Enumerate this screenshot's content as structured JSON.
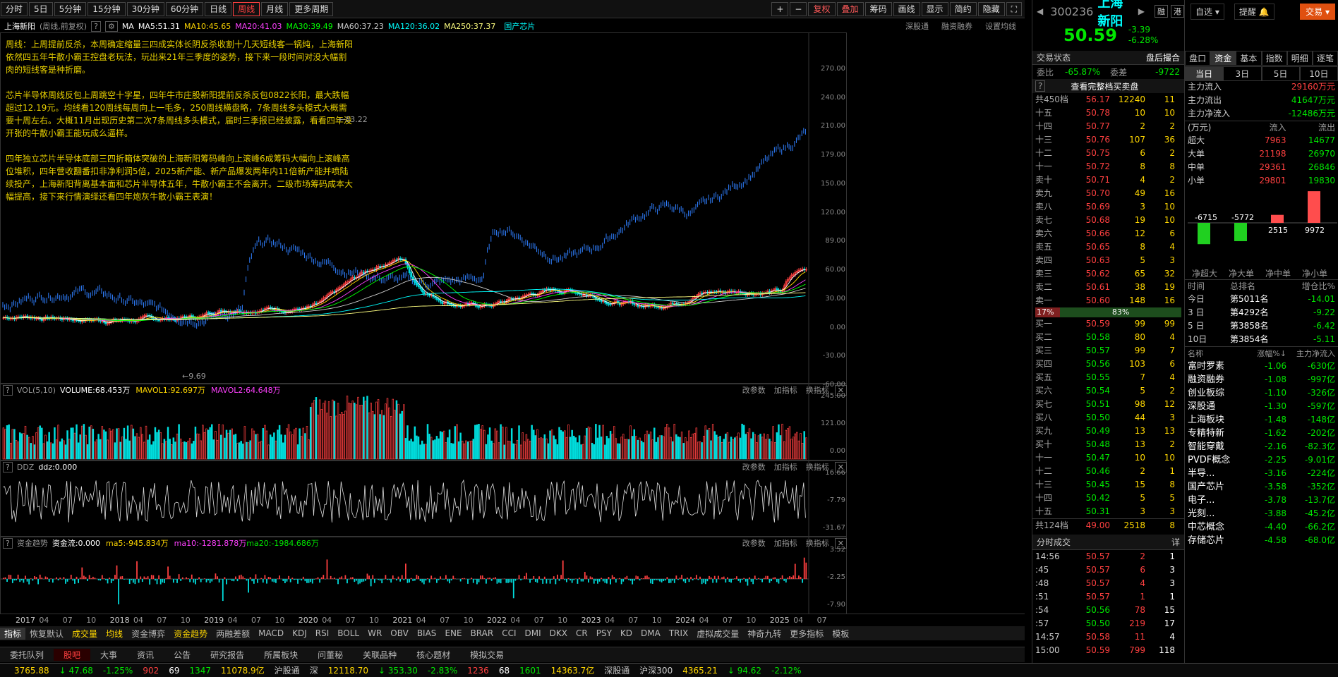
{
  "toolbar": {
    "periods": [
      "分时",
      "5日",
      "5分钟",
      "15分钟",
      "30分钟",
      "60分钟",
      "日线",
      "周线",
      "月线",
      "更多周期"
    ],
    "active": "周线",
    "right": [
      "+",
      "−",
      "复权",
      "叠加",
      "筹码",
      "画线",
      "显示",
      "简约",
      "隐藏"
    ]
  },
  "ma_line": {
    "name": "上海新阳",
    "sub": "(周线,前复权)",
    "ma": "MA",
    "items": [
      {
        "t": "MA5:51.31",
        "c": "#ffffff"
      },
      {
        "t": "MA10:45.65",
        "c": "#ffd700"
      },
      {
        "t": "MA20:41.03",
        "c": "#ff40ff"
      },
      {
        "t": "MA30:39.49",
        "c": "#00ff00"
      },
      {
        "t": "MA60:37.23",
        "c": "#cccccc"
      },
      {
        "t": "MA120:36.02",
        "c": "#00ffff"
      },
      {
        "t": "MA250:37.37",
        "c": "#ffff80"
      }
    ],
    "tag": "国产芯片",
    "links": [
      "深股通",
      "融资融券",
      "设置均线"
    ]
  },
  "note": "周线：上周提前反杀，本周确定缩量三四成实体长阴反杀收割十几天短线客一锅炖，上海新阳依然四五年牛散小霸王控盘老玩法，玩出来21年三季度的姿势，接下来一段时间对没大幅割肉的短线客是种折磨。\n\n芯片半导体周线反包上周跳空十字星，四年牛市庄股新阳提前反杀反包0822长阳，最大跌幅超过12.19元。均线看120周线每周向上一毛多，250周线横盘略，7条周线多头模式大概需要十周左右。大概11月出现历史第二次7条周线多头模式，届时三季报已经披露，看看四年没开张的牛散小霸王能玩成么逼样。\n\n四年独立芯片半导体底部三四折箱体突破的上海新阳筹码峰向上滚峰6成筹码大幅向上滚峰高位堆积，四年营收翻番扣非净利润5倍，2025新产能、新产品爆发两年内11倍新产能并喷陆续投产，上海新阳背离基本面和芯片半导体五年，牛散小霸王不会离开。二级市场筹码成本大幅提高，接下来行情演绎还看四年炮灰牛散小霸王表演！",
  "main_axis": [
    "270.00",
    "240.00",
    "210.00",
    "179.00",
    "150.00",
    "120.00",
    "89.00",
    "60.00",
    "30.00",
    "0.00",
    "-30.00",
    "-60.00"
  ],
  "labels": {
    "high": "83.22",
    "low": "9.69"
  },
  "vol": {
    "head": "VOL(5,10)",
    "volume": "VOLUME:68.453万",
    "mavol1": "MAVOL1:92.697万",
    "mavol2": "MAVOL2:64.648万",
    "axis": [
      "245.00",
      "121.00",
      "0.00"
    ]
  },
  "ddz": {
    "head": "DDZ",
    "val": "ddz:0.000",
    "axis": [
      "16.66",
      "-7.79",
      "-31.67"
    ]
  },
  "zjqs": {
    "head": "资金趋势",
    "val": "资金流:0.000",
    "ma5": "ma5:-945.834万",
    "ma10": "ma10:-1281.878万",
    "ma20": "ma20:-1984.686万",
    "axis": [
      "3.52",
      "-2.25",
      "-7.90"
    ]
  },
  "pane_links": [
    "改参数",
    "加指标",
    "换指标"
  ],
  "time_axis": [
    "2017",
    "04",
    "07",
    "10",
    "2018",
    "04",
    "07",
    "10",
    "2019",
    "04",
    "07",
    "10",
    "2020",
    "04",
    "07",
    "10",
    "2021",
    "04",
    "07",
    "10",
    "2022",
    "04",
    "07",
    "10",
    "2023",
    "04",
    "07",
    "10",
    "2024",
    "04",
    "07",
    "10",
    "2025",
    "04",
    "07"
  ],
  "ind_bar": [
    "指标",
    "恢复默认",
    "成交量",
    "均线",
    "资金博弈",
    "资金趋势",
    "两融差额",
    "MACD",
    "KDJ",
    "RSI",
    "BOLL",
    "WR",
    "OBV",
    "BIAS",
    "ENE",
    "BRAR",
    "CCI",
    "DMI",
    "DKX",
    "CR",
    "PSY",
    "KD",
    "DMA",
    "TRIX",
    "虚拟成交量",
    "神奇九转",
    "更多指标",
    "模板"
  ],
  "bottom_tabs": [
    "委托队列",
    "股吧",
    "大事",
    "资讯",
    "公告",
    "研究报告",
    "所属板块",
    "问董秘",
    "关联品种",
    "核心题材",
    "模拟交易"
  ],
  "status": [
    {
      "t": "3765.88",
      "c": "#ffd700"
    },
    {
      "t": "↓ 47.68",
      "c": "#00e600"
    },
    {
      "t": "-1.25%",
      "c": "#00e600"
    },
    {
      "t": "902",
      "c": "#ff4040"
    },
    {
      "t": "69",
      "c": "#fff"
    },
    {
      "t": "1347",
      "c": "#00e600"
    },
    {
      "t": "11078.9亿",
      "c": "#ffd700"
    },
    {
      "t": "沪股通",
      "c": "#ccc"
    },
    {
      "t": "深",
      "c": "#ccc"
    },
    {
      "t": "12118.70",
      "c": "#ffd700"
    },
    {
      "t": "↓ 353.30",
      "c": "#00e600"
    },
    {
      "t": "-2.83%",
      "c": "#00e600"
    },
    {
      "t": "1236",
      "c": "#ff4040"
    },
    {
      "t": "68",
      "c": "#fff"
    },
    {
      "t": "1601",
      "c": "#00e600"
    },
    {
      "t": "14363.7亿",
      "c": "#ffd700"
    },
    {
      "t": "深股通",
      "c": "#ccc"
    },
    {
      "t": "沪深300",
      "c": "#ccc"
    },
    {
      "t": "4365.21",
      "c": "#ffd700"
    },
    {
      "t": "↓ 94.62",
      "c": "#00e600"
    },
    {
      "t": "-2.12%",
      "c": "#00e600"
    }
  ],
  "quote": {
    "code": "300236",
    "name": "上海新阳",
    "tags": [
      "融",
      "港"
    ],
    "price": "50.59",
    "chg": "-3.39",
    "pct": "-6.28%",
    "watch": "自选",
    "remind": "提醒",
    "trade": "交易"
  },
  "trade_status": {
    "label": "交易状态",
    "val": "盘后撮合",
    "wb_label": "委比",
    "wb": "-65.87%",
    "wc_label": "委差",
    "wc": "-9722",
    "full": "查看完整档买卖盘"
  },
  "sell_total": {
    "l": "共450档",
    "p": "56.17",
    "v": "12240",
    "c": "11"
  },
  "sells": [
    {
      "l": "十五",
      "p": "50.78",
      "v": "10",
      "c": "10"
    },
    {
      "l": "十四",
      "p": "50.77",
      "v": "2",
      "c": "2"
    },
    {
      "l": "十三",
      "p": "50.76",
      "v": "107",
      "c": "36"
    },
    {
      "l": "十二",
      "p": "50.75",
      "v": "6",
      "c": "2"
    },
    {
      "l": "十一",
      "p": "50.72",
      "v": "8",
      "c": "8"
    },
    {
      "l": "卖十",
      "p": "50.71",
      "v": "4",
      "c": "2"
    },
    {
      "l": "卖九",
      "p": "50.70",
      "v": "49",
      "c": "16"
    },
    {
      "l": "卖八",
      "p": "50.69",
      "v": "3",
      "c": "10"
    },
    {
      "l": "卖七",
      "p": "50.68",
      "v": "19",
      "c": "10"
    },
    {
      "l": "卖六",
      "p": "50.66",
      "v": "12",
      "c": "6"
    },
    {
      "l": "卖五",
      "p": "50.65",
      "v": "8",
      "c": "4"
    },
    {
      "l": "卖四",
      "p": "50.63",
      "v": "5",
      "c": "3"
    },
    {
      "l": "卖三",
      "p": "50.62",
      "v": "65",
      "c": "32"
    },
    {
      "l": "卖二",
      "p": "50.61",
      "v": "38",
      "c": "19"
    },
    {
      "l": "卖一",
      "p": "50.60",
      "v": "148",
      "c": "16"
    }
  ],
  "ratio": {
    "left": "17%",
    "right": "83%"
  },
  "buys": [
    {
      "l": "买一",
      "p": "50.59",
      "v": "99",
      "c": "99"
    },
    {
      "l": "买二",
      "p": "50.58",
      "v": "80",
      "c": "4"
    },
    {
      "l": "买三",
      "p": "50.57",
      "v": "99",
      "c": "7"
    },
    {
      "l": "买四",
      "p": "50.56",
      "v": "103",
      "c": "6"
    },
    {
      "l": "买五",
      "p": "50.55",
      "v": "7",
      "c": "4"
    },
    {
      "l": "买六",
      "p": "50.54",
      "v": "5",
      "c": "2"
    },
    {
      "l": "买七",
      "p": "50.51",
      "v": "98",
      "c": "12"
    },
    {
      "l": "买八",
      "p": "50.50",
      "v": "44",
      "c": "3"
    },
    {
      "l": "买九",
      "p": "50.49",
      "v": "13",
      "c": "13"
    },
    {
      "l": "买十",
      "p": "50.48",
      "v": "13",
      "c": "2"
    },
    {
      "l": "十一",
      "p": "50.47",
      "v": "10",
      "c": "10"
    },
    {
      "l": "十二",
      "p": "50.46",
      "v": "2",
      "c": "1"
    },
    {
      "l": "十三",
      "p": "50.45",
      "v": "15",
      "c": "8"
    },
    {
      "l": "十四",
      "p": "50.42",
      "v": "5",
      "c": "5"
    },
    {
      "l": "十五",
      "p": "50.31",
      "v": "3",
      "c": "3"
    }
  ],
  "buy_total": {
    "l": "共124档",
    "p": "49.00",
    "v": "2518",
    "c": "8"
  },
  "ticks_head": "分时成交",
  "ticks_more": "详",
  "ticks": [
    {
      "t": "14:56",
      "p": "50.57",
      "v": "2",
      "c": "1"
    },
    {
      "t": ":45",
      "p": "50.57",
      "v": "6",
      "c": "3"
    },
    {
      "t": ":48",
      "p": "50.57",
      "v": "4",
      "c": "3"
    },
    {
      "t": ":51",
      "p": "50.57",
      "v": "1",
      "c": "1"
    },
    {
      "t": ":54",
      "p": "50.56",
      "v": "78",
      "c": "15"
    },
    {
      "t": ":57",
      "p": "50.50",
      "v": "219",
      "c": "17"
    },
    {
      "t": "14:57",
      "p": "50.58",
      "v": "11",
      "c": "4"
    },
    {
      "t": "15:00",
      "p": "50.59",
      "v": "799",
      "c": "118"
    }
  ],
  "rp2_tabs": [
    "盘口",
    "资金",
    "基本",
    "指数",
    "明细",
    "逐笔"
  ],
  "period_tabs": [
    "当日",
    "3日",
    "5日",
    "10日"
  ],
  "flow": [
    {
      "k": "主力流入",
      "v": "29160万元",
      "c": "red"
    },
    {
      "k": "主力流出",
      "v": "41647万元",
      "c": "grn"
    },
    {
      "k": "主力净流入",
      "v": "-12486万元",
      "c": "grn"
    }
  ],
  "flow_head": {
    "unit": "(万元)",
    "in": "流入",
    "out": "流出"
  },
  "flow_table": [
    {
      "k": "超大",
      "i": "7963",
      "o": "14677"
    },
    {
      "k": "大单",
      "i": "21198",
      "o": "26970"
    },
    {
      "k": "中单",
      "i": "29361",
      "o": "26846"
    },
    {
      "k": "小单",
      "i": "29801",
      "o": "19830"
    }
  ],
  "net_bars": [
    {
      "label": "净超大",
      "v": -6715
    },
    {
      "label": "净大单",
      "v": -5772
    },
    {
      "label": "净中单",
      "v": 2515
    },
    {
      "label": "净小单",
      "v": 9972
    }
  ],
  "net_labels": [
    "-6715",
    "-5772",
    "2515",
    "9972"
  ],
  "rank_head": {
    "t": "时间",
    "r": "总排名",
    "z": "增仓比%"
  },
  "ranks": [
    {
      "t": "今日",
      "r": "第5011名",
      "z": "-14.01"
    },
    {
      "t": "3 日",
      "r": "第4292名",
      "z": "-9.22"
    },
    {
      "t": "5 日",
      "r": "第3858名",
      "z": "-6.42"
    },
    {
      "t": "10日",
      "r": "第3854名",
      "z": "-5.11"
    }
  ],
  "sector_head": {
    "n": "名称",
    "p": "涨幅%↓",
    "f": "主力净流入"
  },
  "sectors": [
    {
      "n": "富时罗素",
      "p": "-1.06",
      "f": "-630亿"
    },
    {
      "n": "融资融券",
      "p": "-1.08",
      "f": "-997亿"
    },
    {
      "n": "创业板综",
      "p": "-1.10",
      "f": "-326亿"
    },
    {
      "n": "深股通",
      "p": "-1.30",
      "f": "-597亿"
    },
    {
      "n": "上海板块",
      "p": "-1.48",
      "f": "-148亿"
    },
    {
      "n": "专精特新",
      "p": "-1.62",
      "f": "-202亿"
    },
    {
      "n": "智能穿戴",
      "p": "-2.16",
      "f": "-82.3亿"
    },
    {
      "n": "PVDF概念",
      "p": "-2.25",
      "f": "-9.01亿"
    },
    {
      "n": "半导...",
      "p": "-3.16",
      "f": "-224亿"
    },
    {
      "n": "国产芯片",
      "p": "-3.58",
      "f": "-352亿"
    },
    {
      "n": "电子...",
      "p": "-3.78",
      "f": "-13.7亿"
    },
    {
      "n": "光刻...",
      "p": "-3.88",
      "f": "-45.2亿"
    },
    {
      "n": "中芯概念",
      "p": "-4.40",
      "f": "-66.2亿"
    },
    {
      "n": "存储芯片",
      "p": "-4.58",
      "f": "-68.0亿"
    }
  ]
}
